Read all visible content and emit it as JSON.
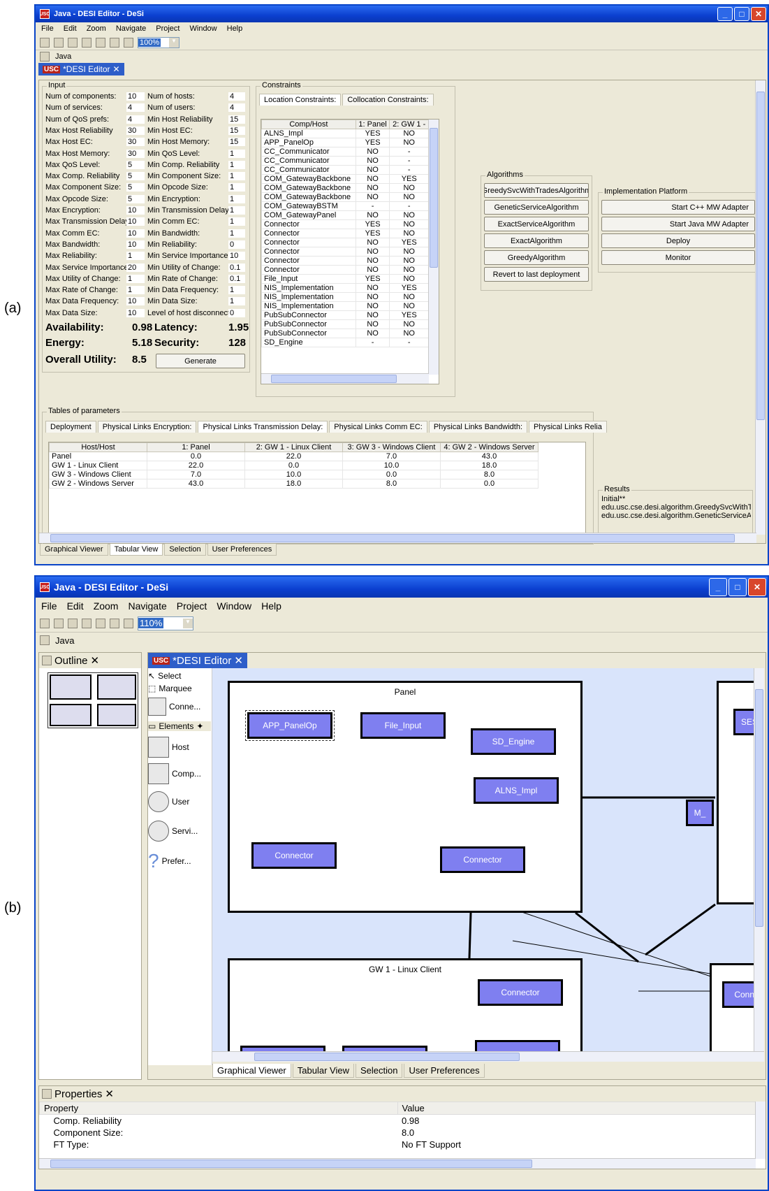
{
  "labels": {
    "a": "(a)",
    "b": "(b)"
  },
  "win": {
    "title": "Java - DESI Editor - DeSi",
    "menus": [
      "File",
      "Edit",
      "Zoom",
      "Navigate",
      "Project",
      "Window",
      "Help"
    ],
    "perspective": "Java",
    "editor_tab": "*DESI Editor",
    "usc": "USC"
  },
  "a": {
    "zoom": "100%",
    "input_legend": "Input",
    "inputs_left": [
      [
        "Num of components:",
        "10"
      ],
      [
        "Num of services:",
        "4"
      ],
      [
        "Num of QoS prefs:",
        "4"
      ],
      [
        "Max Host Reliability",
        "30"
      ],
      [
        "Max Host EC:",
        "30"
      ],
      [
        "Max Host Memory:",
        "30"
      ],
      [
        "Max QoS Level:",
        "5"
      ],
      [
        "Max Comp. Reliability",
        "5"
      ],
      [
        "Max Component Size:",
        "5"
      ],
      [
        "Max Opcode Size:",
        "5"
      ],
      [
        "Max Encryption:",
        "10"
      ],
      [
        "Max Transmission Delay:",
        "10"
      ],
      [
        "Max Comm EC:",
        "10"
      ],
      [
        "Max Bandwidth:",
        "10"
      ],
      [
        "Max Reliability:",
        "1"
      ],
      [
        "Max Service Importance:",
        "20"
      ],
      [
        "Max Utility of Change:",
        "1"
      ],
      [
        "Max Rate of Change:",
        "1"
      ],
      [
        "Max Data Frequency:",
        "10"
      ],
      [
        "Max Data Size:",
        "10"
      ]
    ],
    "inputs_right": [
      [
        "Num of hosts:",
        "4"
      ],
      [
        "Num of users:",
        "4"
      ],
      [
        "Min Host Reliability",
        "15"
      ],
      [
        "Min Host EC:",
        "15"
      ],
      [
        "Min Host Memory:",
        "15"
      ],
      [
        "Min QoS Level:",
        "1"
      ],
      [
        "Min Comp. Reliability",
        "1"
      ],
      [
        "Min Component Size:",
        "1"
      ],
      [
        "Min Opcode Size:",
        "1"
      ],
      [
        "Min Encryption:",
        "1"
      ],
      [
        "Min Transmission Delay:",
        "1"
      ],
      [
        "Min Comm EC:",
        "1"
      ],
      [
        "Min Bandwidth:",
        "1"
      ],
      [
        "Min Reliability:",
        "0"
      ],
      [
        "Min Service Importance:",
        "10"
      ],
      [
        "Min Utility of Change:",
        "0.1"
      ],
      [
        "Min Rate of Change:",
        "0.1"
      ],
      [
        "Min Data Frequency:",
        "1"
      ],
      [
        "Min Data Size:",
        "1"
      ],
      [
        "Level of host disconnect:",
        "0"
      ]
    ],
    "metrics": {
      "availability_label": "Availability:",
      "availability": "0.98",
      "latency_label": "Latency:",
      "latency": "1.95",
      "energy_label": "Energy:",
      "energy": "5.18",
      "security_label": "Security:",
      "security": "128",
      "utility_label": "Overall Utility:",
      "utility": "8.5"
    },
    "generate": "Generate",
    "constraints_legend": "Constraints",
    "constraint_tabs": [
      "Location Constraints:",
      "Collocation Constraints:"
    ],
    "constraint_headers": [
      "Comp/Host",
      "1: Panel",
      "2: GW 1 -"
    ],
    "constraint_rows": [
      [
        "ALNS_Impl",
        "YES",
        "NO"
      ],
      [
        "APP_PanelOp",
        "YES",
        "NO"
      ],
      [
        "CC_Communicator",
        "NO",
        "-"
      ],
      [
        "CC_Communicator",
        "NO",
        "-"
      ],
      [
        "CC_Communicator",
        "NO",
        "-"
      ],
      [
        "COM_GatewayBackbone",
        "NO",
        "YES"
      ],
      [
        "COM_GatewayBackbone",
        "NO",
        "NO"
      ],
      [
        "COM_GatewayBackbone",
        "NO",
        "NO"
      ],
      [
        "COM_GatewayBSTM",
        "-",
        "-"
      ],
      [
        "COM_GatewayPanel",
        "NO",
        "NO"
      ],
      [
        "Connector",
        "YES",
        "NO"
      ],
      [
        "Connector",
        "YES",
        "NO"
      ],
      [
        "Connector",
        "NO",
        "YES"
      ],
      [
        "Connector",
        "NO",
        "NO"
      ],
      [
        "Connector",
        "NO",
        "NO"
      ],
      [
        "Connector",
        "NO",
        "NO"
      ],
      [
        "File_Input",
        "YES",
        "NO"
      ],
      [
        "NIS_Implementation",
        "NO",
        "YES"
      ],
      [
        "NIS_Implementation",
        "NO",
        "NO"
      ],
      [
        "NIS_Implementation",
        "NO",
        "NO"
      ],
      [
        "PubSubConnector",
        "NO",
        "YES"
      ],
      [
        "PubSubConnector",
        "NO",
        "NO"
      ],
      [
        "PubSubConnector",
        "NO",
        "NO"
      ],
      [
        "SD_Engine",
        "-",
        "-"
      ]
    ],
    "algorithms_legend": "Algorithms",
    "algorithms": [
      "GreedySvcWithTradesAlgorithm",
      "GeneticServiceAlgorithm",
      "ExactServiceAlgorithm",
      "ExactAlgorithm",
      "GreedyAlgorithm",
      "Revert to last deployment"
    ],
    "platform_legend": "Implementation Platform",
    "platform": [
      "Start C++ MW Adapter",
      "Start Java MW Adapter",
      "Deploy",
      "Monitor"
    ],
    "params_legend": "Tables of parameters",
    "param_tabs": [
      "Deployment",
      "Physical Links Encryption:",
      "Physical Links Transmission Delay:",
      "Physical Links Comm EC:",
      "Physical Links Bandwidth:",
      "Physical Links Relia"
    ],
    "param_headers": [
      "Host/Host",
      "1: Panel",
      "2: GW 1 - Linux Client",
      "3: GW 3 - Windows Client",
      "4: GW 2 - Windows Server"
    ],
    "param_rows": [
      [
        "Panel",
        "0.0",
        "22.0",
        "7.0",
        "43.0"
      ],
      [
        "GW 1 - Linux Client",
        "22.0",
        "0.0",
        "10.0",
        "18.0"
      ],
      [
        "GW 3 - Windows Client",
        "7.0",
        "10.0",
        "0.0",
        "8.0"
      ],
      [
        "GW 2 - Windows Server",
        "43.0",
        "18.0",
        "8.0",
        "0.0"
      ]
    ],
    "results_legend": "Results",
    "results": [
      "Initial**",
      "edu.usc.cse.desi.algorithm.GreedySvcWithTr",
      "edu.usc.cse.desi.algorithm.GeneticServiceAlg"
    ],
    "view_tabs": [
      "Graphical Viewer",
      "Tabular View",
      "Selection",
      "User Preferences"
    ]
  },
  "b": {
    "zoom": "110%",
    "outline": "Outline",
    "palette": {
      "select": "Select",
      "marquee": "Marquee",
      "conn": "Conne...",
      "elements": "Elements",
      "host": "Host",
      "comp": "Comp...",
      "user": "User",
      "servi": "Servi...",
      "prefer": "Prefer..."
    },
    "panel_title": "Panel",
    "gw1_title": "GW 1 - Linux Client",
    "boxes": {
      "app": "APP_PanelOp",
      "file": "File_Input",
      "sd": "SD_Engine",
      "alns": "ALNS_Impl",
      "conn1": "Connector",
      "conn2": "Connector",
      "conn3": "Connector",
      "ses": "SES_C",
      "m": "M_",
      "conne": "Conne"
    },
    "view_tabs": [
      "Graphical Viewer",
      "Tabular View",
      "Selection",
      "User Preferences"
    ],
    "properties": "Properties",
    "prop_headers": [
      "Property",
      "Value"
    ],
    "prop_rows": [
      [
        "Comp. Reliability",
        "0.98"
      ],
      [
        "Component Size:",
        "8.0"
      ],
      [
        "FT Type:",
        "No FT Support"
      ]
    ]
  }
}
